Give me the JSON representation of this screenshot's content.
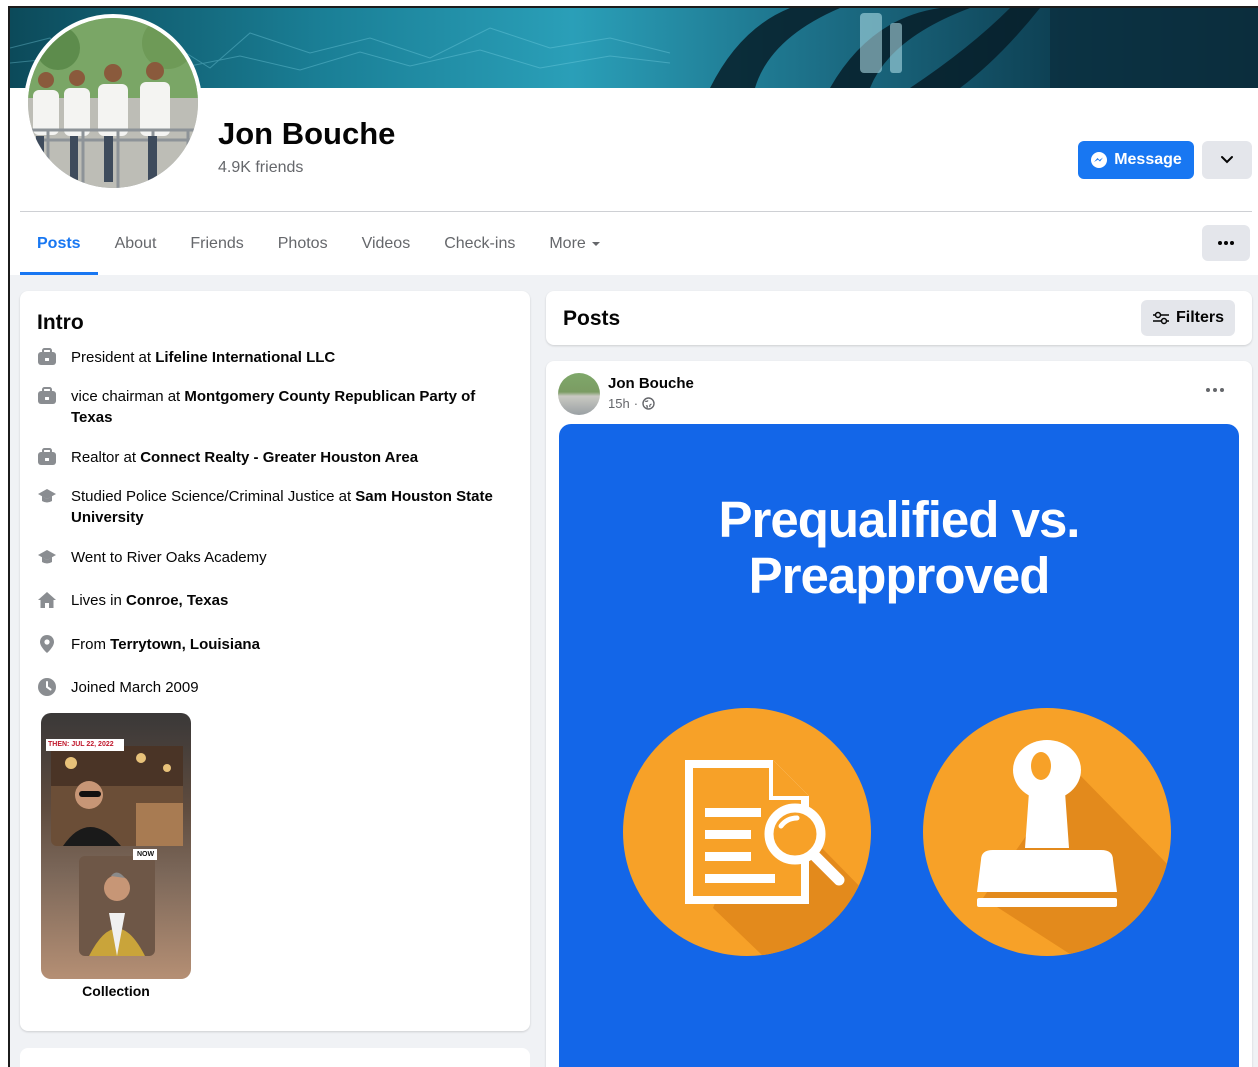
{
  "profile": {
    "name": "Jon Bouche",
    "friends": "4.9K friends",
    "message_label": "Message"
  },
  "tabs": [
    {
      "label": "Posts",
      "active": true
    },
    {
      "label": "About"
    },
    {
      "label": "Friends"
    },
    {
      "label": "Photos"
    },
    {
      "label": "Videos"
    },
    {
      "label": "Check-ins"
    },
    {
      "label": "More"
    }
  ],
  "intro": {
    "title": "Intro",
    "items": [
      {
        "icon": "briefcase-icon",
        "prefix": "President at ",
        "bold": "Lifeline International LLC"
      },
      {
        "icon": "briefcase-icon",
        "prefix": "vice chairman at ",
        "bold": "Montgomery County Republican Party of Texas"
      },
      {
        "icon": "briefcase-icon",
        "prefix": "Realtor at ",
        "bold": "Connect Realty - Greater Houston Area"
      },
      {
        "icon": "graduation-cap-icon",
        "prefix": "Studied Police Science/Criminal Justice at ",
        "bold": "Sam Houston State University"
      },
      {
        "icon": "graduation-cap-icon",
        "prefix": "Went to River Oaks Academy",
        "bold": ""
      },
      {
        "icon": "home-icon",
        "prefix": "Lives in ",
        "bold": "Conroe, Texas"
      },
      {
        "icon": "location-pin-icon",
        "prefix": "From ",
        "bold": "Terrytown, Louisiana"
      },
      {
        "icon": "clock-icon",
        "prefix": "Joined March 2009",
        "bold": ""
      }
    ],
    "collection": {
      "label": "Collection",
      "then_tag": "THEN: JUL 22, 2022",
      "now_tag": "NOW"
    }
  },
  "posts": {
    "title": "Posts",
    "filters_label": "Filters",
    "post": {
      "author": "Jon Bouche",
      "time": "15h",
      "separator": "·",
      "privacy_icon": "globe-icon",
      "image_headline_line1": "Prequalified vs.",
      "image_headline_line2": "Preapproved",
      "image_bg": "#1366e8",
      "circle_color": "#f7a128"
    }
  },
  "colors": {
    "accent": "#1877f2",
    "secondary_button": "#e4e6eb",
    "muted_text": "#65676b",
    "page_bg": "#f0f2f5"
  }
}
